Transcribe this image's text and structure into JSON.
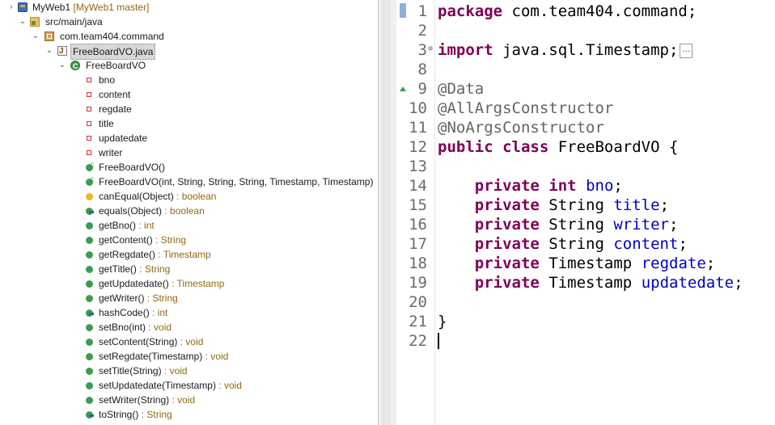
{
  "tree": {
    "project": {
      "label": "MyWeb1",
      "decoration": "[MyWeb1 master]"
    },
    "src_folder": "src/main/java",
    "package": "com.team404.command",
    "file": "FreeBoardVO.java",
    "class": "FreeBoardVO",
    "members": [
      {
        "icon": "field",
        "label": "bno",
        "type": ""
      },
      {
        "icon": "field",
        "label": "content",
        "type": ""
      },
      {
        "icon": "field",
        "label": "regdate",
        "type": ""
      },
      {
        "icon": "field",
        "label": "title",
        "type": ""
      },
      {
        "icon": "field",
        "label": "updatedate",
        "type": ""
      },
      {
        "icon": "field",
        "label": "writer",
        "type": ""
      },
      {
        "icon": "constructor",
        "label": "FreeBoardVO()",
        "type": ""
      },
      {
        "icon": "constructor",
        "label": "FreeBoardVO(int, String, String, String, Timestamp, Timestamp)",
        "type": ""
      },
      {
        "icon": "protected-method",
        "label": "canEqual(Object)",
        "type": " : boolean"
      },
      {
        "icon": "override-method",
        "label": "equals(Object)",
        "type": " : boolean"
      },
      {
        "icon": "public-method",
        "label": "getBno()",
        "type": " : int"
      },
      {
        "icon": "public-method",
        "label": "getContent()",
        "type": " : String"
      },
      {
        "icon": "public-method",
        "label": "getRegdate()",
        "type": " : Timestamp"
      },
      {
        "icon": "public-method",
        "label": "getTitle()",
        "type": " : String"
      },
      {
        "icon": "public-method",
        "label": "getUpdatedate()",
        "type": " : Timestamp"
      },
      {
        "icon": "public-method",
        "label": "getWriter()",
        "type": " : String"
      },
      {
        "icon": "override-method",
        "label": "hashCode()",
        "type": " : int"
      },
      {
        "icon": "public-method",
        "label": "setBno(int)",
        "type": " : void"
      },
      {
        "icon": "public-method",
        "label": "setContent(String)",
        "type": " : void"
      },
      {
        "icon": "public-method",
        "label": "setRegdate(Timestamp)",
        "type": " : void"
      },
      {
        "icon": "public-method",
        "label": "setTitle(String)",
        "type": " : void"
      },
      {
        "icon": "public-method",
        "label": "setUpdatedate(Timestamp)",
        "type": " : void"
      },
      {
        "icon": "public-method",
        "label": "setWriter(String)",
        "type": " : void"
      },
      {
        "icon": "override-method",
        "label": "toString()",
        "type": " : String"
      }
    ]
  },
  "editor": {
    "lines": [
      {
        "num": "1",
        "tokens": [
          [
            "kw",
            "package"
          ],
          [
            "plain",
            " com.team404.command;"
          ]
        ]
      },
      {
        "num": "2",
        "tokens": []
      },
      {
        "num": "3",
        "tokens": [
          [
            "kw",
            "import"
          ],
          [
            "plain",
            " java.sql.Timestamp;"
          ]
        ],
        "collapsed": true
      },
      {
        "num": "8",
        "tokens": []
      },
      {
        "num": "9",
        "tokens": [
          [
            "ann",
            "@Data"
          ]
        ]
      },
      {
        "num": "10",
        "tokens": [
          [
            "ann",
            "@AllArgsConstructor"
          ]
        ]
      },
      {
        "num": "11",
        "tokens": [
          [
            "ann",
            "@NoArgsConstructor"
          ]
        ]
      },
      {
        "num": "12",
        "tokens": [
          [
            "kw",
            "public"
          ],
          [
            "plain",
            " "
          ],
          [
            "kw",
            "class"
          ],
          [
            "plain",
            " FreeBoardVO {"
          ]
        ]
      },
      {
        "num": "13",
        "tokens": []
      },
      {
        "num": "14",
        "tokens": [
          [
            "plain",
            "    "
          ],
          [
            "kw",
            "private"
          ],
          [
            "plain",
            " "
          ],
          [
            "kw",
            "int"
          ],
          [
            "plain",
            " "
          ],
          [
            "fld",
            "bno"
          ],
          [
            "plain",
            ";"
          ]
        ]
      },
      {
        "num": "15",
        "tokens": [
          [
            "plain",
            "    "
          ],
          [
            "kw",
            "private"
          ],
          [
            "plain",
            " String "
          ],
          [
            "fld",
            "title"
          ],
          [
            "plain",
            ";"
          ]
        ]
      },
      {
        "num": "16",
        "tokens": [
          [
            "plain",
            "    "
          ],
          [
            "kw",
            "private"
          ],
          [
            "plain",
            " String "
          ],
          [
            "fld",
            "writer"
          ],
          [
            "plain",
            ";"
          ]
        ]
      },
      {
        "num": "17",
        "tokens": [
          [
            "plain",
            "    "
          ],
          [
            "kw",
            "private"
          ],
          [
            "plain",
            " String "
          ],
          [
            "fld",
            "content"
          ],
          [
            "plain",
            ";"
          ]
        ]
      },
      {
        "num": "18",
        "tokens": [
          [
            "plain",
            "    "
          ],
          [
            "kw",
            "private"
          ],
          [
            "plain",
            " Timestamp "
          ],
          [
            "fld",
            "regdate"
          ],
          [
            "plain",
            ";"
          ]
        ]
      },
      {
        "num": "19",
        "tokens": [
          [
            "plain",
            "    "
          ],
          [
            "kw",
            "private"
          ],
          [
            "plain",
            " Timestamp "
          ],
          [
            "fld",
            "updatedate"
          ],
          [
            "plain",
            ";"
          ]
        ]
      },
      {
        "num": "20",
        "tokens": []
      },
      {
        "num": "21",
        "tokens": [
          [
            "plain",
            "}"
          ]
        ]
      },
      {
        "num": "22",
        "tokens": [],
        "current": true
      }
    ],
    "colors": {
      "keyword": "#7f0055",
      "field": "#0000c0",
      "annotation": "#646464",
      "current_line": "#e8f2fe"
    }
  }
}
